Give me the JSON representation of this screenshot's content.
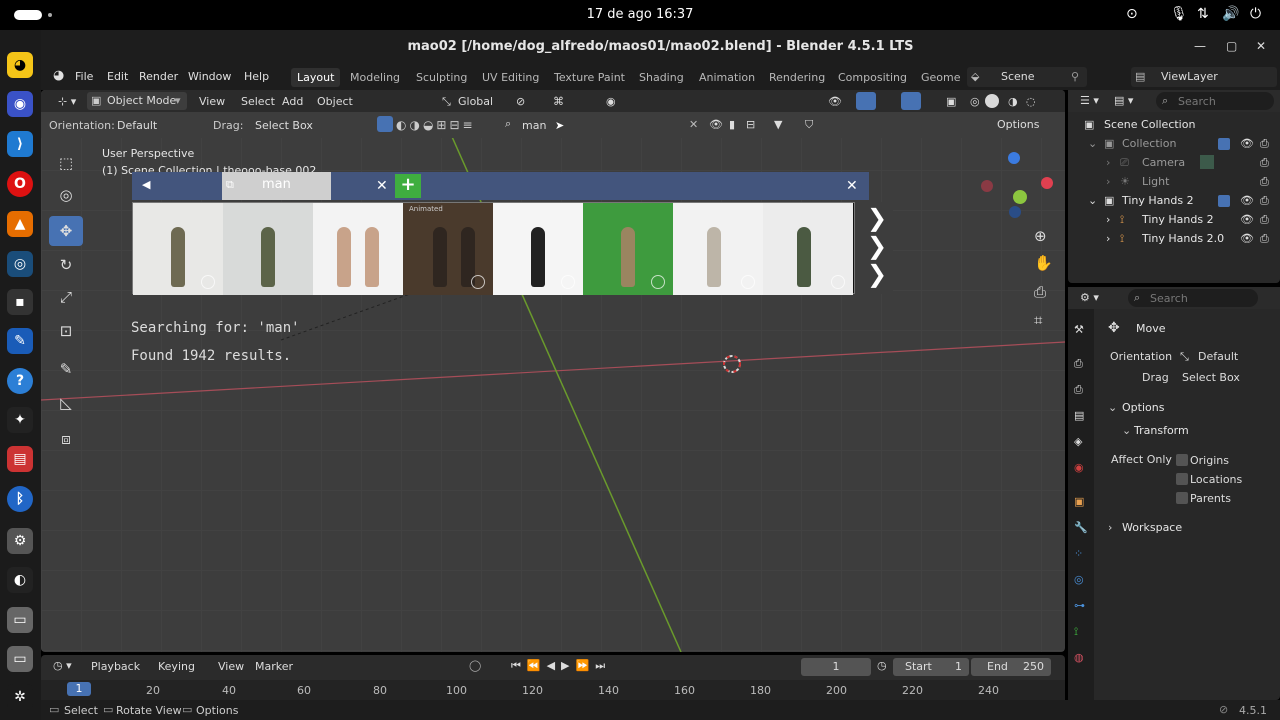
{
  "system": {
    "clock": "17 de ago  16:37"
  },
  "window": {
    "title": "mao02 [/home/dog_alfredo/maos01/mao02.blend] - Blender 4.5.1 LTS"
  },
  "menubar": {
    "items": [
      "File",
      "Edit",
      "Render",
      "Window",
      "Help"
    ],
    "workspaces": [
      "Layout",
      "Modeling",
      "Sculpting",
      "UV Editing",
      "Texture Paint",
      "Shading",
      "Animation",
      "Rendering",
      "Compositing",
      "Geome"
    ],
    "scene": "Scene",
    "view_layer": "ViewLayer"
  },
  "viewport": {
    "mode": "Object Mode",
    "menus": [
      "View",
      "Select",
      "Add",
      "Object"
    ],
    "transform": "Global",
    "orientation_label": "Orientation:",
    "orientation_value": "Default",
    "drag_label": "Drag:",
    "drag_value": "Select Box",
    "search_text": "man",
    "options_label": "Options",
    "view_name": "User Perspective",
    "collection_info": "(1) Scene Collection | theooo-base.002"
  },
  "asset_popup": {
    "search_query": "man",
    "searching_text": "Searching for: 'man'",
    "found_text": "Found 1942 results.",
    "thumb_badge": "Animated",
    "colors": {
      "bar": "#43557d",
      "add": "#3fae3f"
    }
  },
  "outliner": {
    "search_placeholder": "Search",
    "rows": [
      {
        "label": "Scene Collection"
      },
      {
        "label": "Collection"
      },
      {
        "label": "Camera"
      },
      {
        "label": "Light"
      },
      {
        "label": "Tiny Hands 2"
      },
      {
        "label": "Tiny Hands 2"
      },
      {
        "label": "Tiny Hands 2.0"
      }
    ]
  },
  "properties": {
    "search_placeholder": "Search",
    "tool_name": "Move",
    "orientation_label": "Orientation",
    "orientation_value": "Default",
    "drag_label": "Drag",
    "drag_value": "Select Box",
    "options_panel": "Options",
    "transform_panel": "Transform",
    "affect_only": "Affect Only",
    "checks": [
      "Origins",
      "Locations",
      "Parents"
    ],
    "workspace_panel": "Workspace"
  },
  "timeline": {
    "menus": [
      "Playback",
      "Keying",
      "View",
      "Marker"
    ],
    "current_frame": "1",
    "start_label": "Start",
    "start_value": "1",
    "end_label": "End",
    "end_value": "250",
    "ruler": [
      "1",
      "20",
      "40",
      "60",
      "80",
      "100",
      "120",
      "140",
      "160",
      "180",
      "200",
      "220",
      "240"
    ]
  },
  "statusbar": {
    "items": [
      "Select",
      "Rotate View",
      "Options"
    ],
    "version": "4.5.1"
  }
}
